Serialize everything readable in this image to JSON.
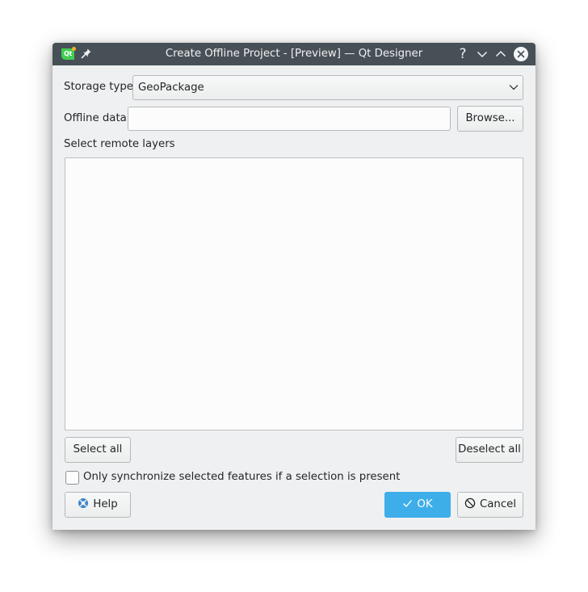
{
  "window": {
    "title": "Create Offline Project - [Preview] — Qt Designer",
    "logo_text": "Qt",
    "icons": {
      "logo": "qt-logo-icon",
      "pin": "pin-icon",
      "help": "question-mark-icon",
      "minimize": "chevron-down-icon",
      "maximize": "chevron-up-icon",
      "close": "close-circle-icon"
    },
    "help_glyph": "?"
  },
  "form": {
    "storage_type": {
      "label": "Storage type",
      "value": "GeoPackage"
    },
    "offline_data": {
      "label": "Offline data",
      "value": "",
      "placeholder": "",
      "browse_label": "Browse..."
    },
    "remote_layers": {
      "label": "Select remote layers",
      "items": []
    },
    "select_all_label": "Select all",
    "deselect_all_label": "Deselect all",
    "only_selected": {
      "label": "Only synchronize selected features if a selection is present",
      "checked": false
    }
  },
  "buttons": {
    "help_label": "Help",
    "ok_label": "OK",
    "cancel_label": "Cancel"
  },
  "colors": {
    "titlebar": "#475057",
    "window_bg": "#eff0f1",
    "accent": "#3daee9",
    "help_icon": "#3c84c6"
  }
}
